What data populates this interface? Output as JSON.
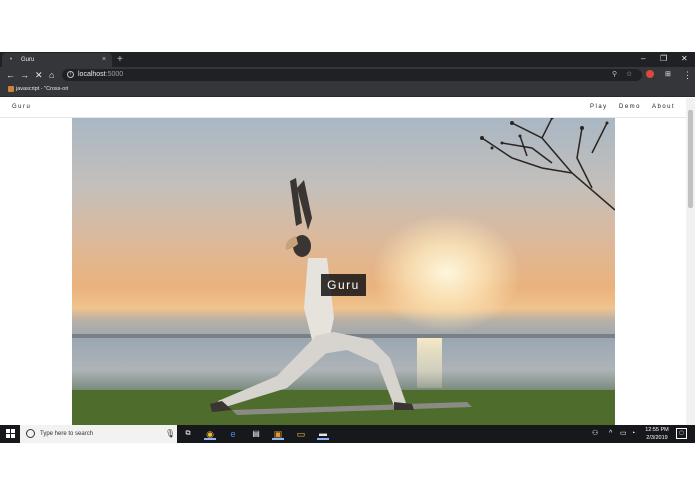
{
  "browser": {
    "tab_title": "Guru",
    "new_tab": "+",
    "tab_close": "×",
    "minimize": "–",
    "restore": "❐",
    "close": "✕",
    "url_host": "localhost",
    "url_port": ":5000",
    "bookmark_label": "javascript - \"Cross-ori",
    "icons": [
      "back-icon",
      "forward-icon",
      "stop-icon",
      "home-icon",
      "info-icon",
      "zoom-icon",
      "star-icon",
      "menu-icon"
    ]
  },
  "page": {
    "brand": "Guru",
    "nav": {
      "play": "Play",
      "demo": "Demo",
      "about": "About"
    },
    "hero_title": "Guru"
  },
  "taskbar": {
    "search_placeholder": "Type here to search",
    "clock_time": "12:55 PM",
    "clock_date": "2/3/2019"
  },
  "colors": {
    "chrome_dark": "#202124",
    "chrome_toolbar": "#35363a",
    "taskbar": "#17181c",
    "hero_caption_bg": "#141414"
  }
}
